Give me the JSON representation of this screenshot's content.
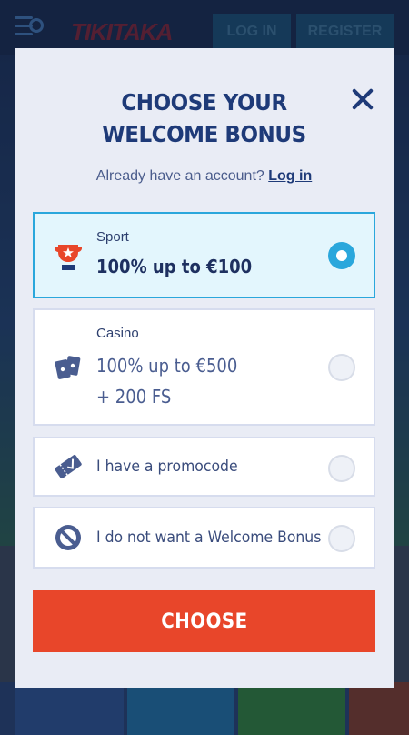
{
  "background": {
    "menu_icon": "menu-search-icon",
    "logo_text": "TIKITAKA",
    "login_label": "LOG IN",
    "register_label": "REGISTER"
  },
  "modal": {
    "title_line1": "CHOOSE YOUR",
    "title_line2": "WELCOME BONUS",
    "account_prompt": "Already have an account?",
    "login_link": "Log in",
    "close_icon": "close-icon",
    "options": [
      {
        "icon": "trophy-icon",
        "label": "Sport",
        "value": "100% up to €100",
        "selected": true
      },
      {
        "icon": "cards-icon",
        "label": "Casino",
        "value_line1": "100% up to €500",
        "value_line2": "+ 200 FS",
        "selected": false
      },
      {
        "icon": "ticket-icon",
        "text": "I have a promocode",
        "selected": false
      },
      {
        "icon": "no-bonus-icon",
        "text": "I do not want a Welcome Bonus",
        "selected": false
      }
    ],
    "choose_label": "CHOOSE"
  },
  "colors": {
    "accent": "#2aa7dc",
    "primary_text": "#1e3a78",
    "cta": "#e8462a",
    "modal_bg": "#e9ecf5"
  }
}
